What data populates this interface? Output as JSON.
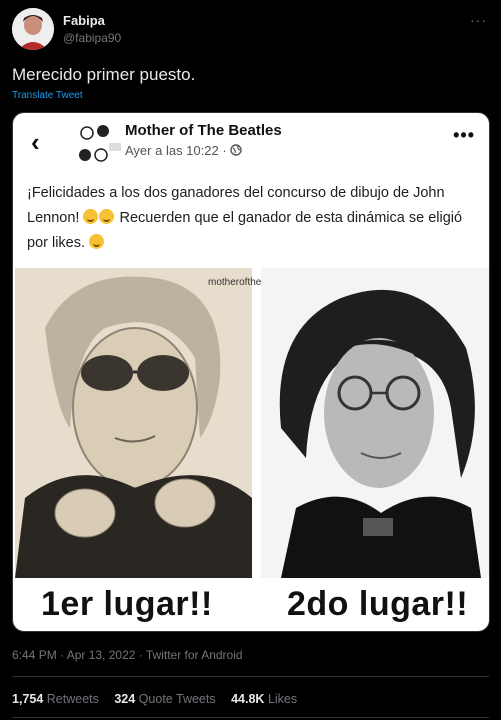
{
  "tweet": {
    "display_name": "Fabipa",
    "handle": "@fabipa90",
    "text": "Merecido primer puesto.",
    "translate_label": "Translate Tweet",
    "timestamp": "6:44 PM · Apr 13, 2022 · Twitter for Android",
    "stats": {
      "retweets_count": "1,754",
      "retweets_label": "Retweets",
      "quote_count": "324",
      "quote_label": "Quote Tweets",
      "likes_count": "44.8K",
      "likes_label": "Likes"
    }
  },
  "embedded_post": {
    "back_glyph": "‹",
    "page_name": "Mother of The Beatles",
    "time": "Ayer a las 10:22 ·",
    "more_glyph": "•••",
    "text_part1": "¡Felicidades a los dos ganadores del concurso de dibujo de John Lennon!",
    "text_part2": " Recuerden que el ganador de esta dinámica se eligió por likes.",
    "watermark": "motherofthebeatles",
    "caption_first": "1er lugar!!",
    "caption_second": "2do lugar!!"
  },
  "icons": [
    "more-icon",
    "globe-icon",
    "back-chevron-icon",
    "partying-face-emoji",
    "star-struck-emoji"
  ]
}
